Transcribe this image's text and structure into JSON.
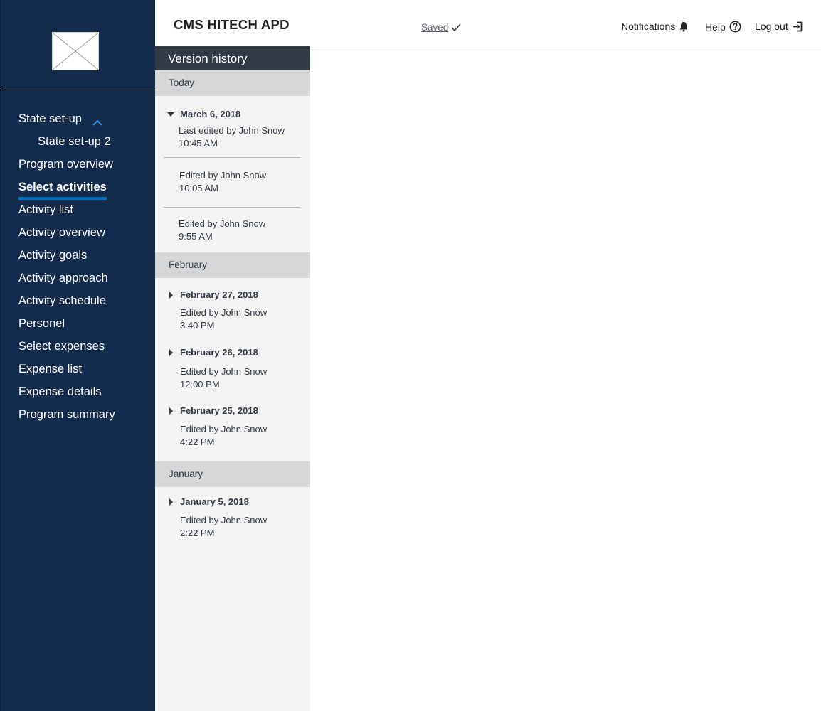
{
  "sidebar": {
    "items": [
      {
        "label": "State set-up"
      },
      {
        "label": "State set-up 2"
      },
      {
        "label": "Program overview"
      },
      {
        "label": "Select activities"
      },
      {
        "label": "Activity list"
      },
      {
        "label": "Activity overview"
      },
      {
        "label": "Activity goals"
      },
      {
        "label": "Activity approach"
      },
      {
        "label": "Activity schedule"
      },
      {
        "label": "Personel"
      },
      {
        "label": "Select expenses"
      },
      {
        "label": "Expense list"
      },
      {
        "label": "Expense details"
      },
      {
        "label": "Program summary"
      }
    ]
  },
  "header": {
    "title": "CMS HITECH APD",
    "saved": "Saved",
    "notifications": "Notifications",
    "help": "Help",
    "logout": "Log out"
  },
  "version_history": {
    "title": "Version history",
    "groups": [
      {
        "label": "Today",
        "dates": [
          {
            "date": "March 6, 2018",
            "entries": [
              {
                "by": "Last edited by John Snow",
                "time": "10:45 AM"
              },
              {
                "by": "Edited by John Snow",
                "time": "10:05 AM"
              },
              {
                "by": "Edited by John Snow",
                "time": "9:55 AM"
              }
            ]
          }
        ]
      },
      {
        "label": "February",
        "dates": [
          {
            "date": "February 27, 2018",
            "entries": [
              {
                "by": "Edited by John Snow",
                "time": "3:40 PM"
              }
            ]
          },
          {
            "date": "February 26, 2018",
            "entries": [
              {
                "by": "Edited by John Snow",
                "time": "12:00 PM"
              }
            ]
          },
          {
            "date": "February 25, 2018",
            "entries": [
              {
                "by": "Edited by John Snow",
                "time": "4:22 PM"
              }
            ]
          }
        ]
      },
      {
        "label": "January",
        "dates": [
          {
            "date": "January 5, 2018",
            "entries": [
              {
                "by": "Edited by John Snow",
                "time": "2:22 PM"
              }
            ]
          }
        ]
      }
    ]
  },
  "colors": {
    "sidebar_bg": "#132b4c",
    "accent": "#0071bc",
    "panel_title_bg": "#323a45",
    "group_bg": "#d6d7d9",
    "panel_bg": "#f4f4f4"
  },
  "icons": {
    "logo": "image-placeholder-icon",
    "expand": "chevron-up-icon",
    "saved": "checkmark-icon",
    "notifications": "bell-icon",
    "help": "question-circle-icon",
    "logout": "logout-icon"
  }
}
